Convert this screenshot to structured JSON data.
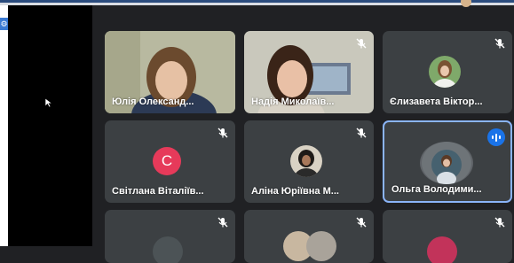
{
  "top_bar": {
    "accent": "#2b4c7e"
  },
  "left_toolbar": {
    "icon": "gear-icon"
  },
  "participants": [
    {
      "name": "Юлія Олександ...",
      "muted": false,
      "video": true
    },
    {
      "name": "Надія Миколаїв...",
      "muted": true,
      "video": true
    },
    {
      "name": "Єлизавета Віктор...",
      "muted": true,
      "video": false,
      "avatar": "photo"
    },
    {
      "name": "Світлана Віталіїв...",
      "muted": true,
      "video": false,
      "avatar": "initial",
      "initial": "С"
    },
    {
      "name": "Аліна Юріївна М...",
      "muted": true,
      "video": false,
      "avatar": "photo"
    },
    {
      "name": "Ольга Володими...",
      "muted": false,
      "speaking": true,
      "video": false,
      "avatar": "photo"
    },
    {
      "name": "",
      "muted": true,
      "video": false
    },
    {
      "name": "",
      "muted": true,
      "video": false
    },
    {
      "name": "",
      "muted": true,
      "video": false
    }
  ],
  "colors": {
    "tile_bg": "#3c4043",
    "active_border": "#8ab4f8",
    "speaking": "#1a73e8",
    "initial_avatar": "#e63a5a"
  }
}
